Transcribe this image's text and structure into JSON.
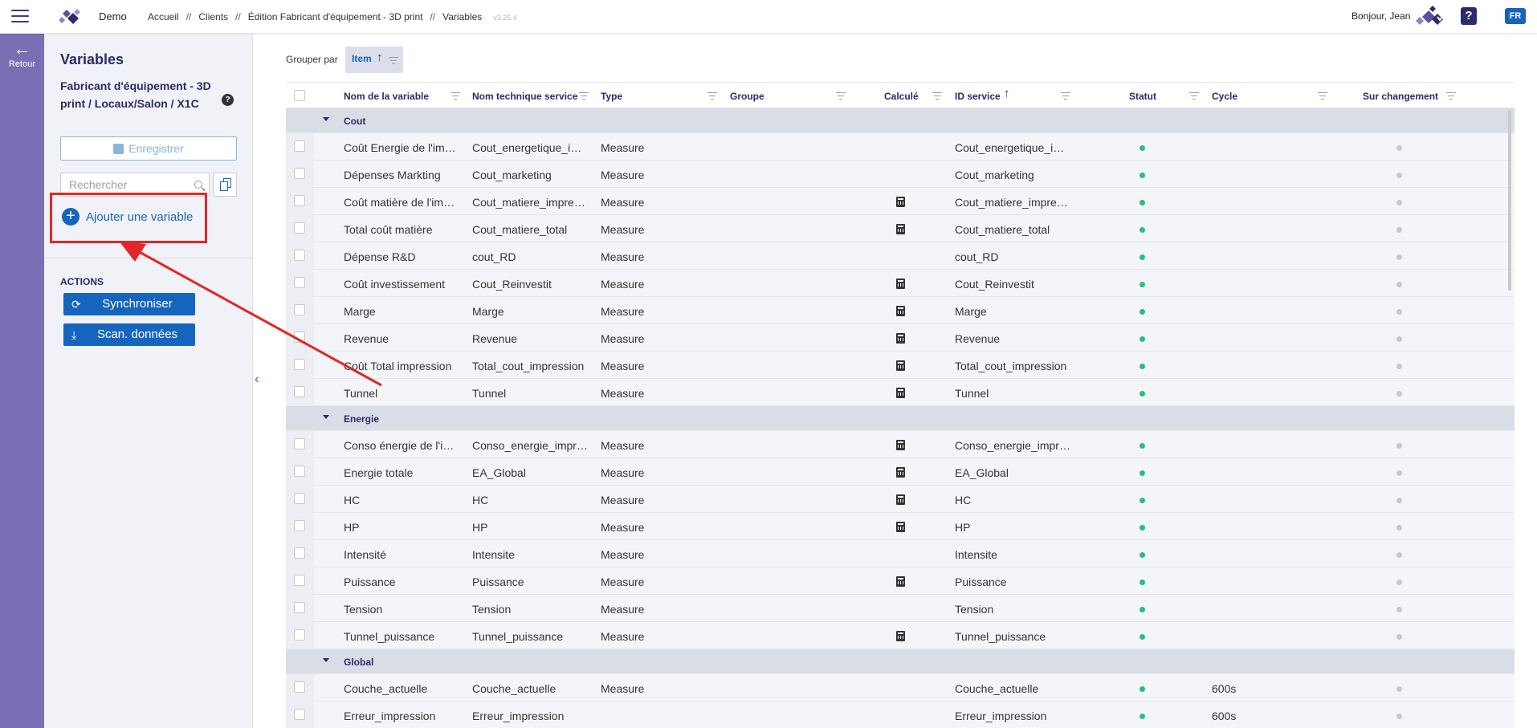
{
  "topbar": {
    "app_name": "Demo",
    "breadcrumb": [
      "Accueil",
      "Clients",
      "Édition Fabricant d'équipement - 3D print",
      "Variables"
    ],
    "separator": "//",
    "version": "v3.25.4",
    "greeting": "Bonjour, Jean",
    "help_label": "?",
    "lang": "FR",
    "accent": "#1565c0",
    "rail_color": "#7a6fb4"
  },
  "rail": {
    "back_label": "Retour"
  },
  "panel": {
    "title": "Variables",
    "subtitle": "Fabricant d'équipement - 3D print / Locaux/Salon / X1C",
    "help": "?",
    "save_label": "Enregistrer",
    "search_placeholder": "Rechercher",
    "add_variable_label": "Ajouter une variable",
    "actions_title": "ACTIONS",
    "actions": [
      {
        "label": "Synchroniser",
        "icon": "sync-icon"
      },
      {
        "label": "Scan. données",
        "icon": "download-icon"
      }
    ]
  },
  "main": {
    "groupby_label": "Grouper par",
    "groupby_chip": "Item",
    "columns": {
      "name": "Nom de la variable",
      "tech": "Nom technique service",
      "type": "Type",
      "group": "Groupe",
      "calc": "Calculé",
      "id": "ID service",
      "status": "Statut",
      "cycle": "Cycle",
      "change": "Sur changement"
    },
    "groups": [
      {
        "name": "Cout",
        "rows": [
          {
            "name": "Coût Energie de l'im…",
            "tech": "Cout_energetique_i…",
            "type": "Measure",
            "calc": false,
            "id": "Cout_energetique_i…",
            "cycle": ""
          },
          {
            "name": "Dépenses Markting",
            "tech": "Cout_marketing",
            "type": "Measure",
            "calc": false,
            "id": "Cout_marketing",
            "cycle": ""
          },
          {
            "name": "Coût matière de l'im…",
            "tech": "Cout_matiere_impre…",
            "type": "Measure",
            "calc": true,
            "id": "Cout_matiere_impre…",
            "cycle": ""
          },
          {
            "name": "Total coût matière",
            "tech": "Cout_matiere_total",
            "type": "Measure",
            "calc": true,
            "id": "Cout_matiere_total",
            "cycle": ""
          },
          {
            "name": "Dépense R&D",
            "tech": "cout_RD",
            "type": "Measure",
            "calc": false,
            "id": "cout_RD",
            "cycle": ""
          },
          {
            "name": "Coût investissement",
            "tech": "Cout_Reinvestit",
            "type": "Measure",
            "calc": true,
            "id": "Cout_Reinvestit",
            "cycle": ""
          },
          {
            "name": "Marge",
            "tech": "Marge",
            "type": "Measure",
            "calc": true,
            "id": "Marge",
            "cycle": ""
          },
          {
            "name": "Revenue",
            "tech": "Revenue",
            "type": "Measure",
            "calc": true,
            "id": "Revenue",
            "cycle": ""
          },
          {
            "name": "Coût Total impression",
            "tech": "Total_cout_impression",
            "type": "Measure",
            "calc": true,
            "id": "Total_cout_impression",
            "cycle": ""
          },
          {
            "name": "Tunnel",
            "tech": "Tunnel",
            "type": "Measure",
            "calc": true,
            "id": "Tunnel",
            "cycle": ""
          }
        ]
      },
      {
        "name": "Energie",
        "rows": [
          {
            "name": "Conso énergie de l'i…",
            "tech": "Conso_energie_impr…",
            "type": "Measure",
            "calc": true,
            "id": "Conso_energie_impr…",
            "cycle": ""
          },
          {
            "name": "Energie totale",
            "tech": "EA_Global",
            "type": "Measure",
            "calc": true,
            "id": "EA_Global",
            "cycle": ""
          },
          {
            "name": "HC",
            "tech": "HC",
            "type": "Measure",
            "calc": true,
            "id": "HC",
            "cycle": ""
          },
          {
            "name": "HP",
            "tech": "HP",
            "type": "Measure",
            "calc": true,
            "id": "HP",
            "cycle": ""
          },
          {
            "name": "Intensité",
            "tech": "Intensite",
            "type": "Measure",
            "calc": false,
            "id": "Intensite",
            "cycle": ""
          },
          {
            "name": "Puissance",
            "tech": "Puissance",
            "type": "Measure",
            "calc": true,
            "id": "Puissance",
            "cycle": ""
          },
          {
            "name": "Tension",
            "tech": "Tension",
            "type": "Measure",
            "calc": false,
            "id": "Tension",
            "cycle": ""
          },
          {
            "name": "Tunnel_puissance",
            "tech": "Tunnel_puissance",
            "type": "Measure",
            "calc": true,
            "id": "Tunnel_puissance",
            "cycle": ""
          }
        ]
      },
      {
        "name": "Global",
        "rows": [
          {
            "name": "Couche_actuelle",
            "tech": "Couche_actuelle",
            "type": "Measure",
            "calc": false,
            "id": "Couche_actuelle",
            "cycle": "600s"
          },
          {
            "name": "Erreur_impression",
            "tech": "Erreur_impression",
            "type": "",
            "calc": false,
            "id": "Erreur_impression",
            "cycle": "600s"
          }
        ]
      }
    ]
  }
}
